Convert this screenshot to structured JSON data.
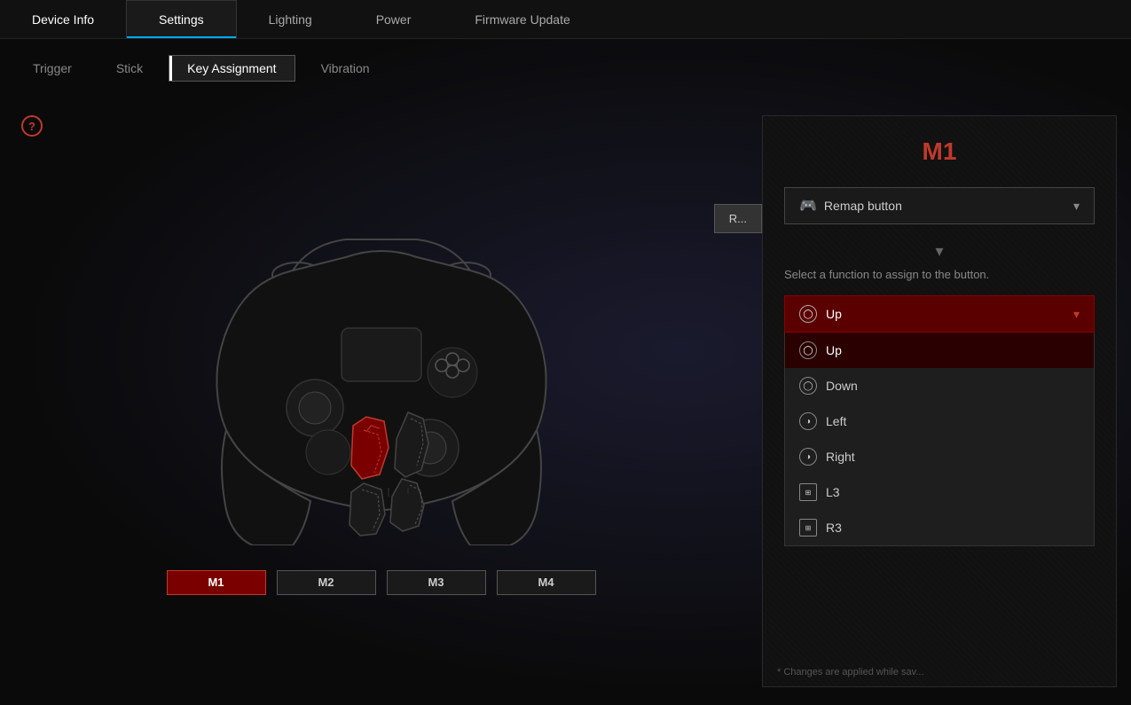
{
  "nav": {
    "items": [
      {
        "id": "device-info",
        "label": "Device Info",
        "active": false
      },
      {
        "id": "settings",
        "label": "Settings",
        "active": true
      },
      {
        "id": "lighting",
        "label": "Lighting",
        "active": false
      },
      {
        "id": "power",
        "label": "Power",
        "active": false
      },
      {
        "id": "firmware-update",
        "label": "Firmware Update",
        "active": false
      }
    ]
  },
  "subtabs": {
    "items": [
      {
        "id": "trigger",
        "label": "Trigger",
        "active": false
      },
      {
        "id": "stick",
        "label": "Stick",
        "active": false
      },
      {
        "id": "key-assignment",
        "label": "Key Assignment",
        "active": true
      },
      {
        "id": "vibration",
        "label": "Vibration",
        "active": false
      }
    ]
  },
  "panel": {
    "title": "M1",
    "remap_label": "Remap button",
    "instruction": "Select a function to assign to the button.",
    "selected_function": "Up",
    "functions": [
      {
        "id": "up",
        "label": "Up",
        "icon": "◯",
        "selected": true
      },
      {
        "id": "down",
        "label": "Down",
        "icon": "◯",
        "selected": false
      },
      {
        "id": "left",
        "label": "Left",
        "icon": "◑",
        "selected": false
      },
      {
        "id": "right",
        "label": "Right",
        "icon": "◑",
        "selected": false
      },
      {
        "id": "l3",
        "label": "L3",
        "icon": "⊞",
        "selected": false
      },
      {
        "id": "r3",
        "label": "R3",
        "icon": "⊞",
        "selected": false
      }
    ],
    "bottom_note": "* Changes are applied while sav..."
  },
  "m_buttons": [
    {
      "id": "m1",
      "label": "M1",
      "active": true
    },
    {
      "id": "m2",
      "label": "M2",
      "active": false
    },
    {
      "id": "m3",
      "label": "M3",
      "active": false
    },
    {
      "id": "m4",
      "label": "M4",
      "active": false
    }
  ],
  "top_right_btn": "R...",
  "icons": {
    "help": "?",
    "chevron_down": "▾",
    "arrow_down": "▾",
    "gamepad": "🎮"
  }
}
